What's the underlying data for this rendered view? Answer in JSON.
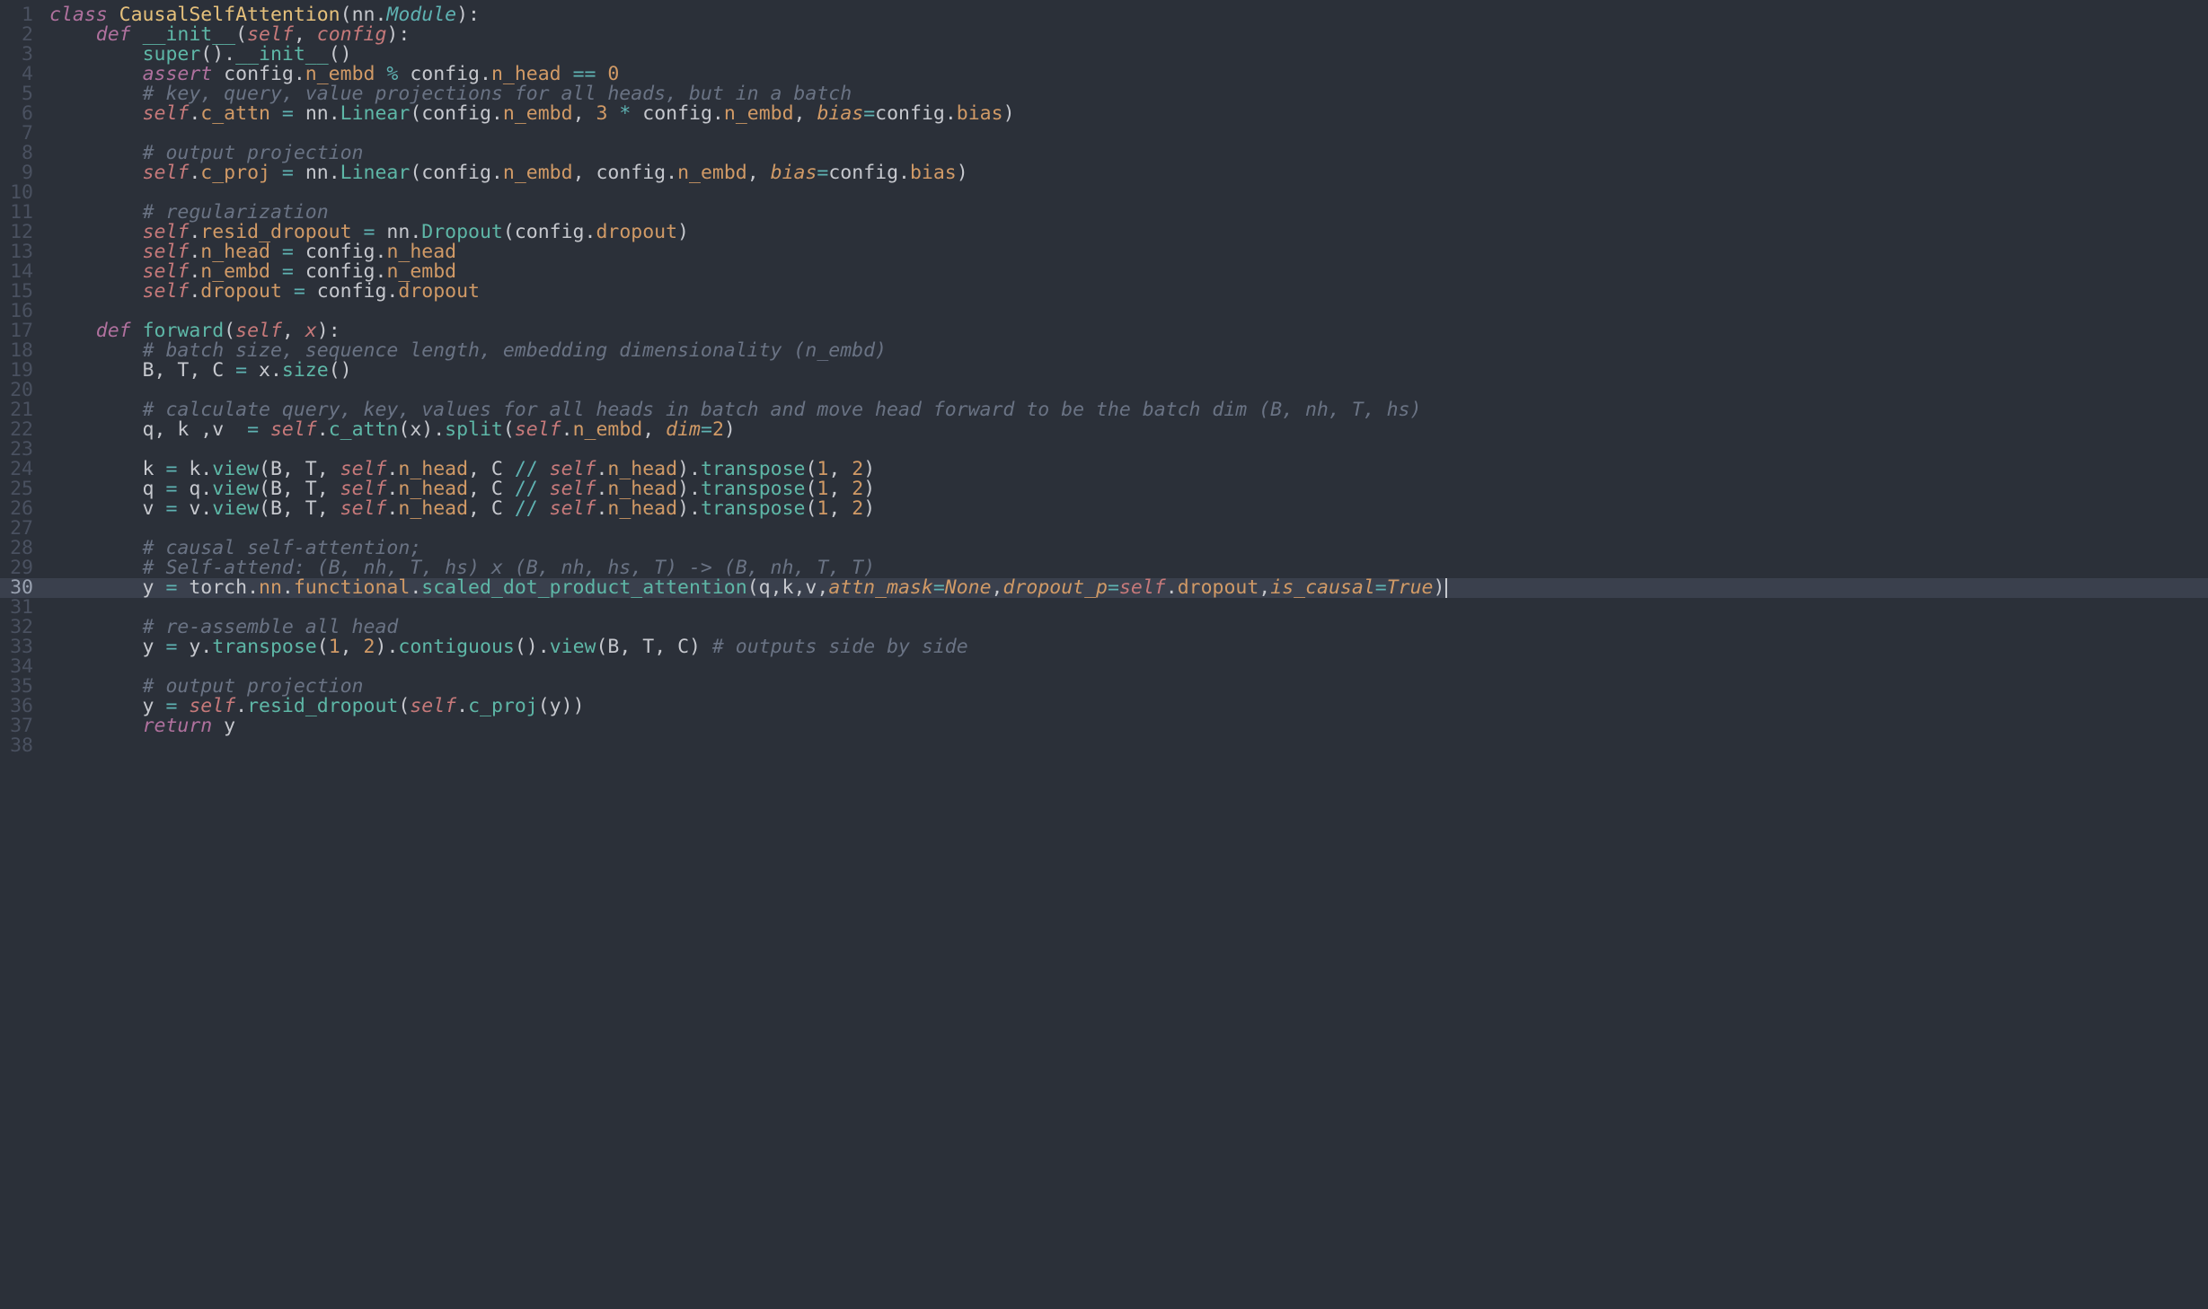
{
  "colors": {
    "background": "#2b3039",
    "gutter": "#4a5160",
    "gutter_active": "#9aa2b1",
    "highlight_bg": "#3a404d",
    "default_fg": "#c6c8ce",
    "keyword": "#b0719e",
    "class_name": "#e5c07b",
    "type": "#5fb3b3",
    "fn_def": "#5eb7a7",
    "self": "#c6797a",
    "attr": "#d19a66",
    "fn_call": "#5eb7a7",
    "number": "#d19a66",
    "comment": "#6a7384",
    "const": "#d19a66"
  },
  "highlighted_line": 30,
  "lines": [
    {
      "n": 1,
      "tokens": [
        [
          "kw",
          "class "
        ],
        [
          "cls",
          "CausalSelfAttention"
        ],
        [
          "pun",
          "("
        ],
        [
          "id",
          "nn"
        ],
        [
          "pun",
          "."
        ],
        [
          "type",
          "Module"
        ],
        [
          "pun",
          "):"
        ]
      ]
    },
    {
      "n": 2,
      "tokens": [
        [
          "pun",
          "    "
        ],
        [
          "kw",
          "def "
        ],
        [
          "fndef",
          "__init__"
        ],
        [
          "pun",
          "("
        ],
        [
          "self",
          "self"
        ],
        [
          "pun",
          ", "
        ],
        [
          "prm",
          "config"
        ],
        [
          "pun",
          "):"
        ]
      ]
    },
    {
      "n": 3,
      "tokens": [
        [
          "pun",
          "        "
        ],
        [
          "fn",
          "super"
        ],
        [
          "pun",
          "()."
        ],
        [
          "fn",
          "__init__"
        ],
        [
          "pun",
          "()"
        ]
      ]
    },
    {
      "n": 4,
      "tokens": [
        [
          "pun",
          "        "
        ],
        [
          "kw",
          "assert"
        ],
        [
          "pun",
          " config."
        ],
        [
          "attr",
          "n_embd"
        ],
        [
          "pun",
          " "
        ],
        [
          "op",
          "%"
        ],
        [
          "pun",
          " config."
        ],
        [
          "attr",
          "n_head"
        ],
        [
          "pun",
          " "
        ],
        [
          "op",
          "=="
        ],
        [
          "pun",
          " "
        ],
        [
          "num",
          "0"
        ]
      ]
    },
    {
      "n": 5,
      "tokens": [
        [
          "pun",
          "        "
        ],
        [
          "cmt",
          "# key, query, value projections for all heads, but in a batch"
        ]
      ]
    },
    {
      "n": 6,
      "tokens": [
        [
          "pun",
          "        "
        ],
        [
          "self",
          "self"
        ],
        [
          "pun",
          "."
        ],
        [
          "attr",
          "c_attn"
        ],
        [
          "pun",
          " "
        ],
        [
          "op",
          "="
        ],
        [
          "pun",
          " nn."
        ],
        [
          "fn",
          "Linear"
        ],
        [
          "pun",
          "(config."
        ],
        [
          "attr",
          "n_embd"
        ],
        [
          "pun",
          ", "
        ],
        [
          "num",
          "3"
        ],
        [
          "pun",
          " "
        ],
        [
          "op",
          "*"
        ],
        [
          "pun",
          " config."
        ],
        [
          "attr",
          "n_embd"
        ],
        [
          "pun",
          ", "
        ],
        [
          "kwarg",
          "bias"
        ],
        [
          "op",
          "="
        ],
        [
          "pun",
          "config."
        ],
        [
          "attr",
          "bias"
        ],
        [
          "pun",
          ")"
        ]
      ]
    },
    {
      "n": 7,
      "tokens": []
    },
    {
      "n": 8,
      "tokens": [
        [
          "pun",
          "        "
        ],
        [
          "cmt",
          "# output projection"
        ]
      ]
    },
    {
      "n": 9,
      "tokens": [
        [
          "pun",
          "        "
        ],
        [
          "self",
          "self"
        ],
        [
          "pun",
          "."
        ],
        [
          "attr",
          "c_proj"
        ],
        [
          "pun",
          " "
        ],
        [
          "op",
          "="
        ],
        [
          "pun",
          " nn."
        ],
        [
          "fn",
          "Linear"
        ],
        [
          "pun",
          "(config."
        ],
        [
          "attr",
          "n_embd"
        ],
        [
          "pun",
          ", config."
        ],
        [
          "attr",
          "n_embd"
        ],
        [
          "pun",
          ", "
        ],
        [
          "kwarg",
          "bias"
        ],
        [
          "op",
          "="
        ],
        [
          "pun",
          "config."
        ],
        [
          "attr",
          "bias"
        ],
        [
          "pun",
          ")"
        ]
      ]
    },
    {
      "n": 10,
      "tokens": []
    },
    {
      "n": 11,
      "tokens": [
        [
          "pun",
          "        "
        ],
        [
          "cmt",
          "# regularization"
        ]
      ]
    },
    {
      "n": 12,
      "tokens": [
        [
          "pun",
          "        "
        ],
        [
          "self",
          "self"
        ],
        [
          "pun",
          "."
        ],
        [
          "attr",
          "resid_dropout"
        ],
        [
          "pun",
          " "
        ],
        [
          "op",
          "="
        ],
        [
          "pun",
          " nn."
        ],
        [
          "fn",
          "Dropout"
        ],
        [
          "pun",
          "(config."
        ],
        [
          "attr",
          "dropout"
        ],
        [
          "pun",
          ")"
        ]
      ]
    },
    {
      "n": 13,
      "tokens": [
        [
          "pun",
          "        "
        ],
        [
          "self",
          "self"
        ],
        [
          "pun",
          "."
        ],
        [
          "attr",
          "n_head"
        ],
        [
          "pun",
          " "
        ],
        [
          "op",
          "="
        ],
        [
          "pun",
          " config."
        ],
        [
          "attr",
          "n_head"
        ]
      ]
    },
    {
      "n": 14,
      "tokens": [
        [
          "pun",
          "        "
        ],
        [
          "self",
          "self"
        ],
        [
          "pun",
          "."
        ],
        [
          "attr",
          "n_embd"
        ],
        [
          "pun",
          " "
        ],
        [
          "op",
          "="
        ],
        [
          "pun",
          " config."
        ],
        [
          "attr",
          "n_embd"
        ]
      ]
    },
    {
      "n": 15,
      "tokens": [
        [
          "pun",
          "        "
        ],
        [
          "self",
          "self"
        ],
        [
          "pun",
          "."
        ],
        [
          "attr",
          "dropout"
        ],
        [
          "pun",
          " "
        ],
        [
          "op",
          "="
        ],
        [
          "pun",
          " config."
        ],
        [
          "attr",
          "dropout"
        ]
      ]
    },
    {
      "n": 16,
      "tokens": []
    },
    {
      "n": 17,
      "tokens": [
        [
          "pun",
          "    "
        ],
        [
          "kw",
          "def "
        ],
        [
          "fndef",
          "forward"
        ],
        [
          "pun",
          "("
        ],
        [
          "self",
          "self"
        ],
        [
          "pun",
          ", "
        ],
        [
          "prm",
          "x"
        ],
        [
          "pun",
          "):"
        ]
      ]
    },
    {
      "n": 18,
      "tokens": [
        [
          "pun",
          "        "
        ],
        [
          "cmt",
          "# batch size, sequence length, embedding dimensionality (n_embd)"
        ]
      ]
    },
    {
      "n": 19,
      "tokens": [
        [
          "pun",
          "        B, T, C "
        ],
        [
          "op",
          "="
        ],
        [
          "pun",
          " x."
        ],
        [
          "fn",
          "size"
        ],
        [
          "pun",
          "()"
        ]
      ]
    },
    {
      "n": 20,
      "tokens": []
    },
    {
      "n": 21,
      "tokens": [
        [
          "pun",
          "        "
        ],
        [
          "cmt",
          "# calculate query, key, values for all heads in batch and move head forward to be the batch dim (B, nh, T, hs)"
        ]
      ]
    },
    {
      "n": 22,
      "tokens": [
        [
          "pun",
          "        q, k ,v  "
        ],
        [
          "op",
          "="
        ],
        [
          "pun",
          " "
        ],
        [
          "self",
          "self"
        ],
        [
          "pun",
          "."
        ],
        [
          "fn",
          "c_attn"
        ],
        [
          "pun",
          "(x)."
        ],
        [
          "fn",
          "split"
        ],
        [
          "pun",
          "("
        ],
        [
          "self",
          "self"
        ],
        [
          "pun",
          "."
        ],
        [
          "attr",
          "n_embd"
        ],
        [
          "pun",
          ", "
        ],
        [
          "kwarg",
          "dim"
        ],
        [
          "op",
          "="
        ],
        [
          "num",
          "2"
        ],
        [
          "pun",
          ")"
        ]
      ]
    },
    {
      "n": 23,
      "tokens": []
    },
    {
      "n": 24,
      "tokens": [
        [
          "pun",
          "        k "
        ],
        [
          "op",
          "="
        ],
        [
          "pun",
          " k."
        ],
        [
          "fn",
          "view"
        ],
        [
          "pun",
          "(B, T, "
        ],
        [
          "self",
          "self"
        ],
        [
          "pun",
          "."
        ],
        [
          "attr",
          "n_head"
        ],
        [
          "pun",
          ", C "
        ],
        [
          "op",
          "//"
        ],
        [
          "pun",
          " "
        ],
        [
          "self",
          "self"
        ],
        [
          "pun",
          "."
        ],
        [
          "attr",
          "n_head"
        ],
        [
          "pun",
          ")."
        ],
        [
          "fn",
          "transpose"
        ],
        [
          "pun",
          "("
        ],
        [
          "num",
          "1"
        ],
        [
          "pun",
          ", "
        ],
        [
          "num",
          "2"
        ],
        [
          "pun",
          ")"
        ]
      ]
    },
    {
      "n": 25,
      "tokens": [
        [
          "pun",
          "        q "
        ],
        [
          "op",
          "="
        ],
        [
          "pun",
          " q."
        ],
        [
          "fn",
          "view"
        ],
        [
          "pun",
          "(B, T, "
        ],
        [
          "self",
          "self"
        ],
        [
          "pun",
          "."
        ],
        [
          "attr",
          "n_head"
        ],
        [
          "pun",
          ", C "
        ],
        [
          "op",
          "//"
        ],
        [
          "pun",
          " "
        ],
        [
          "self",
          "self"
        ],
        [
          "pun",
          "."
        ],
        [
          "attr",
          "n_head"
        ],
        [
          "pun",
          ")."
        ],
        [
          "fn",
          "transpose"
        ],
        [
          "pun",
          "("
        ],
        [
          "num",
          "1"
        ],
        [
          "pun",
          ", "
        ],
        [
          "num",
          "2"
        ],
        [
          "pun",
          ")"
        ]
      ]
    },
    {
      "n": 26,
      "tokens": [
        [
          "pun",
          "        v "
        ],
        [
          "op",
          "="
        ],
        [
          "pun",
          " v."
        ],
        [
          "fn",
          "view"
        ],
        [
          "pun",
          "(B, T, "
        ],
        [
          "self",
          "self"
        ],
        [
          "pun",
          "."
        ],
        [
          "attr",
          "n_head"
        ],
        [
          "pun",
          ", C "
        ],
        [
          "op",
          "//"
        ],
        [
          "pun",
          " "
        ],
        [
          "self",
          "self"
        ],
        [
          "pun",
          "."
        ],
        [
          "attr",
          "n_head"
        ],
        [
          "pun",
          ")."
        ],
        [
          "fn",
          "transpose"
        ],
        [
          "pun",
          "("
        ],
        [
          "num",
          "1"
        ],
        [
          "pun",
          ", "
        ],
        [
          "num",
          "2"
        ],
        [
          "pun",
          ")"
        ]
      ]
    },
    {
      "n": 27,
      "tokens": []
    },
    {
      "n": 28,
      "tokens": [
        [
          "pun",
          "        "
        ],
        [
          "cmt",
          "# causal self-attention;"
        ]
      ]
    },
    {
      "n": 29,
      "tokens": [
        [
          "pun",
          "        "
        ],
        [
          "cmt",
          "# Self-attend: (B, nh, T, hs) x (B, nh, hs, T) -> (B, nh, T, T)"
        ]
      ]
    },
    {
      "n": 30,
      "tokens": [
        [
          "pun",
          "        y "
        ],
        [
          "op",
          "="
        ],
        [
          "pun",
          " torch."
        ],
        [
          "attr",
          "nn"
        ],
        [
          "pun",
          "."
        ],
        [
          "attr",
          "functional"
        ],
        [
          "pun",
          "."
        ],
        [
          "fn",
          "scaled_dot_product_attention"
        ],
        [
          "pun",
          "(q,k,v,"
        ],
        [
          "kwarg",
          "attn_mask"
        ],
        [
          "op",
          "="
        ],
        [
          "const",
          "None"
        ],
        [
          "pun",
          ","
        ],
        [
          "kwarg",
          "dropout_p"
        ],
        [
          "op",
          "="
        ],
        [
          "self",
          "self"
        ],
        [
          "pun",
          "."
        ],
        [
          "attr",
          "dropout"
        ],
        [
          "pun",
          ","
        ],
        [
          "kwarg",
          "is_causal"
        ],
        [
          "op",
          "="
        ],
        [
          "const",
          "True"
        ],
        [
          "pun",
          ")"
        ]
      ]
    },
    {
      "n": 31,
      "tokens": []
    },
    {
      "n": 32,
      "tokens": [
        [
          "pun",
          "        "
        ],
        [
          "cmt",
          "# re-assemble all head"
        ]
      ]
    },
    {
      "n": 33,
      "tokens": [
        [
          "pun",
          "        y "
        ],
        [
          "op",
          "="
        ],
        [
          "pun",
          " y."
        ],
        [
          "fn",
          "transpose"
        ],
        [
          "pun",
          "("
        ],
        [
          "num",
          "1"
        ],
        [
          "pun",
          ", "
        ],
        [
          "num",
          "2"
        ],
        [
          "pun",
          ")."
        ],
        [
          "fn",
          "contiguous"
        ],
        [
          "pun",
          "()."
        ],
        [
          "fn",
          "view"
        ],
        [
          "pun",
          "(B, T, C) "
        ],
        [
          "cmt",
          "# outputs side by side"
        ]
      ]
    },
    {
      "n": 34,
      "tokens": []
    },
    {
      "n": 35,
      "tokens": [
        [
          "pun",
          "        "
        ],
        [
          "cmt",
          "# output projection"
        ]
      ]
    },
    {
      "n": 36,
      "tokens": [
        [
          "pun",
          "        y "
        ],
        [
          "op",
          "="
        ],
        [
          "pun",
          " "
        ],
        [
          "self",
          "self"
        ],
        [
          "pun",
          "."
        ],
        [
          "fn",
          "resid_dropout"
        ],
        [
          "pun",
          "("
        ],
        [
          "self",
          "self"
        ],
        [
          "pun",
          "."
        ],
        [
          "fn",
          "c_proj"
        ],
        [
          "pun",
          "(y))"
        ]
      ]
    },
    {
      "n": 37,
      "tokens": [
        [
          "pun",
          "        "
        ],
        [
          "kw",
          "return"
        ],
        [
          "pun",
          " y"
        ]
      ]
    },
    {
      "n": 38,
      "tokens": []
    }
  ]
}
